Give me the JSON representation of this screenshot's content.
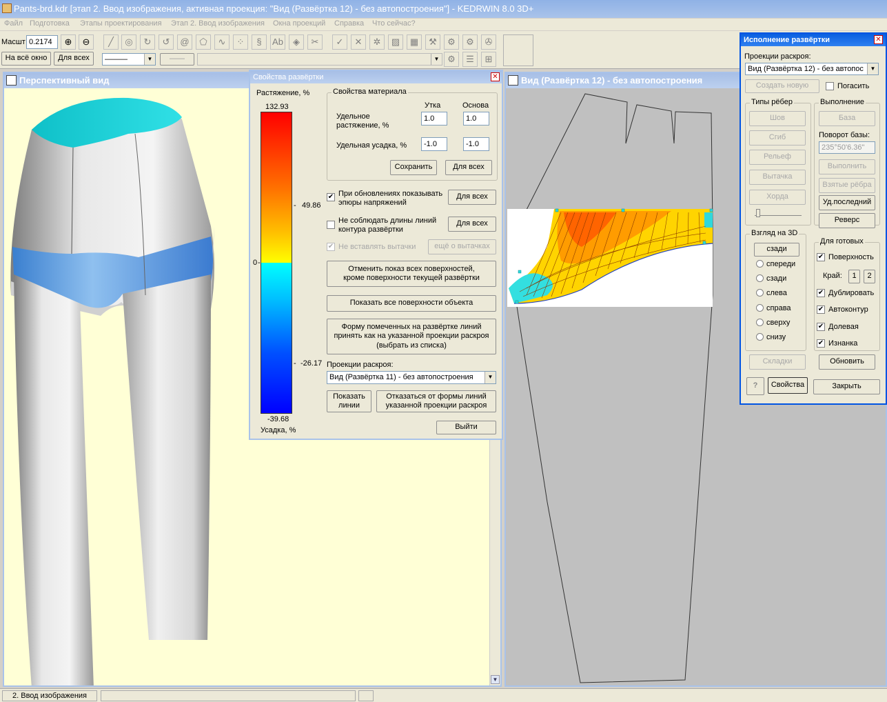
{
  "app": {
    "title": "Pants-brd.kdr [этап 2. Ввод изображения, активная проекция: \"Вид (Развёртка 12) - без автопостроения\"] - KEDRWIN 8.0 3D+"
  },
  "menu": [
    "Файл",
    "Подготовка",
    "Этапы проектирования",
    "Этап 2. Ввод изображения",
    "Окна проекций",
    "Справка",
    "Что сейчас?"
  ],
  "toolbar": {
    "scale_label": "Масшт",
    "scale_value": "0.2174",
    "fit_button": "На всё окно",
    "all_button": "Для всех"
  },
  "perspective": {
    "title": "Перспективный вид"
  },
  "props": {
    "title": "Свойства развёртки",
    "stretch_label": "Растяжение, %",
    "scale_top": "132.93",
    "scale_mid": "49.86",
    "scale_zero": "0",
    "scale_low": "-26.17",
    "scale_bottom": "-39.68",
    "shrink_label": "Усадка, %",
    "material_group": "Свойства материала",
    "weft": "Утка",
    "warp": "Основа",
    "specific_stretch": "Удельное растяжение, %",
    "specific_shrink": "Удельная усадка, %",
    "stretch_weft": "1.0",
    "stretch_warp": "1.0",
    "shrink_weft": "-1.0",
    "shrink_warp": "-1.0",
    "save": "Сохранить",
    "for_all": "Для всех",
    "chk_show_stress": "При обновлениях показывать эпюры напряжений",
    "chk_ignore_length": "Не соблюдать длины линий контура развёртки",
    "chk_no_darts": "Не вставлять вытачки",
    "more_darts": "ещё о вытачках",
    "cancel_surfaces": "Отменить показ всех поверхностей, кроме поверхности текущей развёртки",
    "show_all": "Показать все поверхности объекта",
    "accept_shape": "Форму помеченных на развёртке линий принять как на указанной проекции раскроя (выбрать из списка)",
    "projections_label": "Проекции раскроя:",
    "projection_value": "Вид (Развёртка 11) - без автопостроения",
    "show_lines": "Показать линии",
    "reject_shape": "Отказаться от формы линий указанной проекции раскроя",
    "exit": "Выйти"
  },
  "view": {
    "title": "Вид (Развёртка 12) - без автопостроения"
  },
  "exec": {
    "title": "Исполнение развёртки",
    "projections_label": "Проекции раскроя:",
    "projection_value": "Вид (Развёртка 12) - без автопос",
    "create_new": "Создать новую",
    "hide": "Погасить",
    "rib_types": "Типы рёбер",
    "ribs": [
      "Шов",
      "Сгиб",
      "Рельеф",
      "Вытачка",
      "Хорда"
    ],
    "execution": "Выполнение",
    "base": "База",
    "base_rotation": "Поворот базы:",
    "rotation_value": "235°50'6.36\"",
    "run": "Выполнить",
    "taken_ribs": "Взятые рёбра",
    "delete_last": "Уд.последний",
    "reverse": "Реверс",
    "view3d": "Взгляд на 3D",
    "views": [
      "сзади",
      "спереди",
      "сзади",
      "слева",
      "справа",
      "сверху",
      "снизу"
    ],
    "for_ready": "Для готовых",
    "surface": "Поверхность",
    "edge": "Край:",
    "edge1": "1",
    "edge2": "2",
    "duplicate": "Дублировать",
    "autocontour": "Автоконтур",
    "grain": "Долевая",
    "reverse_side": "Изнанка",
    "folds": "Складки",
    "update": "Обновить",
    "help": "?",
    "properties": "Свойства",
    "close": "Закрыть"
  },
  "status": {
    "stage": "2. Ввод изображения"
  },
  "colors": {
    "accent": "#0a246a",
    "title_active": "#0054e3",
    "heat_hot": "#ff0000",
    "heat_cold": "#0000ff"
  }
}
